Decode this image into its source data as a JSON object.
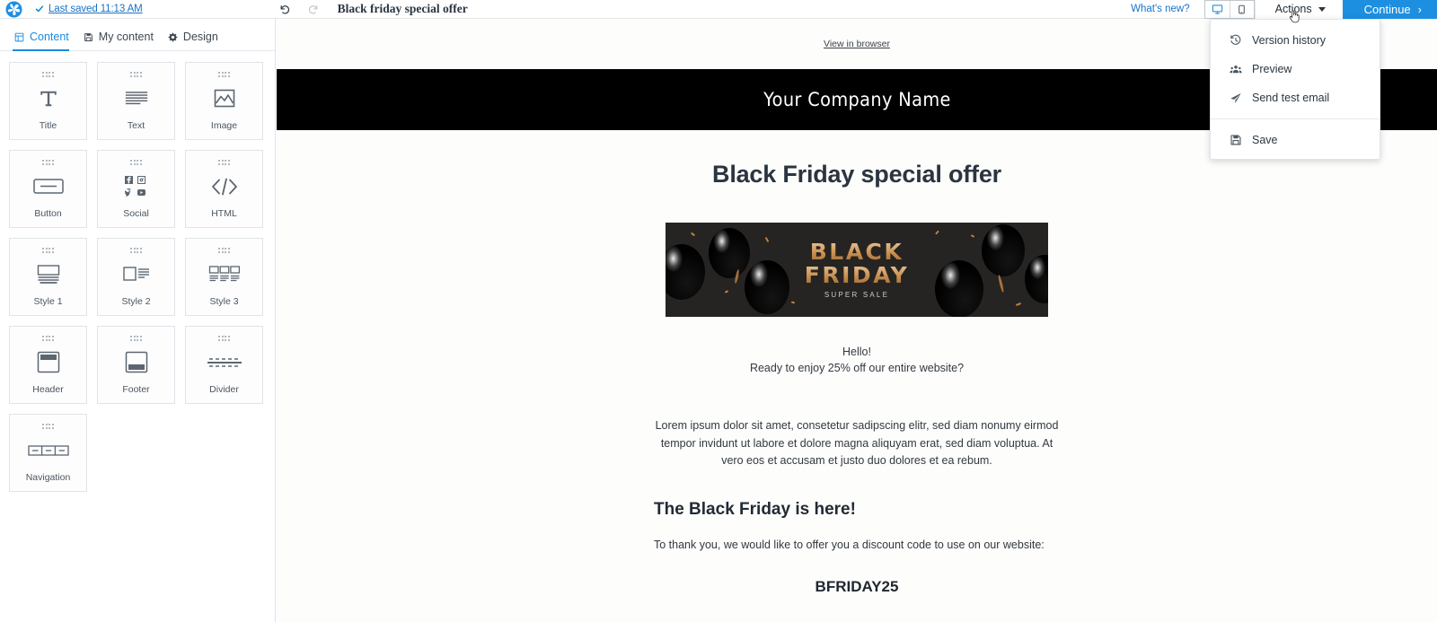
{
  "topbar": {
    "logo_icon": "brevo-pinwheel-logo",
    "check_icon": "check-icon",
    "saved_label": "Last saved 11:13 AM",
    "undo_icon": "undo-icon",
    "redo_icon": "redo-icon",
    "document_title": "Black friday special offer",
    "whats_new_label": "What's new?",
    "desktop_icon": "desktop-icon",
    "mobile_icon": "mobile-icon",
    "actions_label": "Actions",
    "continue_label": "Continue",
    "continue_arrow": "›",
    "accent_color": "#1d8fe0",
    "link_color": "#1a73c7"
  },
  "actions_menu": {
    "items": [
      {
        "label": "Version history",
        "icon": "history-clock-icon"
      },
      {
        "label": "Preview",
        "icon": "people-preview-icon"
      },
      {
        "label": "Send test email",
        "icon": "paper-plane-icon"
      },
      {
        "label": "Save",
        "icon": "floppy-disk-save-icon"
      }
    ]
  },
  "sidebar": {
    "tabs": [
      {
        "label": "Content",
        "icon": "grid-icon",
        "active": true
      },
      {
        "label": "My content",
        "icon": "archive-icon",
        "active": false
      },
      {
        "label": "Design",
        "icon": "gear-icon",
        "active": false
      }
    ],
    "blocks": [
      {
        "label": "Title",
        "icon": "title-T-icon"
      },
      {
        "label": "Text",
        "icon": "text-lines-icon"
      },
      {
        "label": "Image",
        "icon": "image-icon"
      },
      {
        "label": "Button",
        "icon": "button-icon"
      },
      {
        "label": "Social",
        "icon": "social-networks-icon"
      },
      {
        "label": "HTML",
        "icon": "code-html-icon"
      },
      {
        "label": "Style 1",
        "icon": "layout-style-1-icon"
      },
      {
        "label": "Style 2",
        "icon": "layout-style-2-icon"
      },
      {
        "label": "Style 3",
        "icon": "layout-style-3-icon"
      },
      {
        "label": "Header",
        "icon": "header-block-icon"
      },
      {
        "label": "Footer",
        "icon": "footer-block-icon"
      },
      {
        "label": "Divider",
        "icon": "divider-icon"
      },
      {
        "label": "Navigation",
        "icon": "navigation-icon"
      }
    ]
  },
  "email": {
    "view_in_browser": "View in browser",
    "company_name": "Your Company Name",
    "heading": "Black Friday special offer",
    "banner": {
      "line1": "BLACK",
      "line2": "FRIDAY",
      "subtitle": "SUPER SALE",
      "background_color": "#262422",
      "gold_color": "#c98f50"
    },
    "hello": "Hello!",
    "intro": "Ready to enjoy 25% off our entire website?",
    "lorem": "Lorem ipsum dolor sit amet, consetetur sadipscing elitr, sed diam nonumy eirmod tempor invidunt ut labore et dolore magna aliquyam erat, sed diam voluptua. At vero eos et accusam et justo duo dolores et ea rebum.",
    "subheading": "The Black Friday is here!",
    "thanks": "To thank you, we would like to offer you a discount code to use on our website:",
    "discount_code": "BFRIDAY25"
  }
}
